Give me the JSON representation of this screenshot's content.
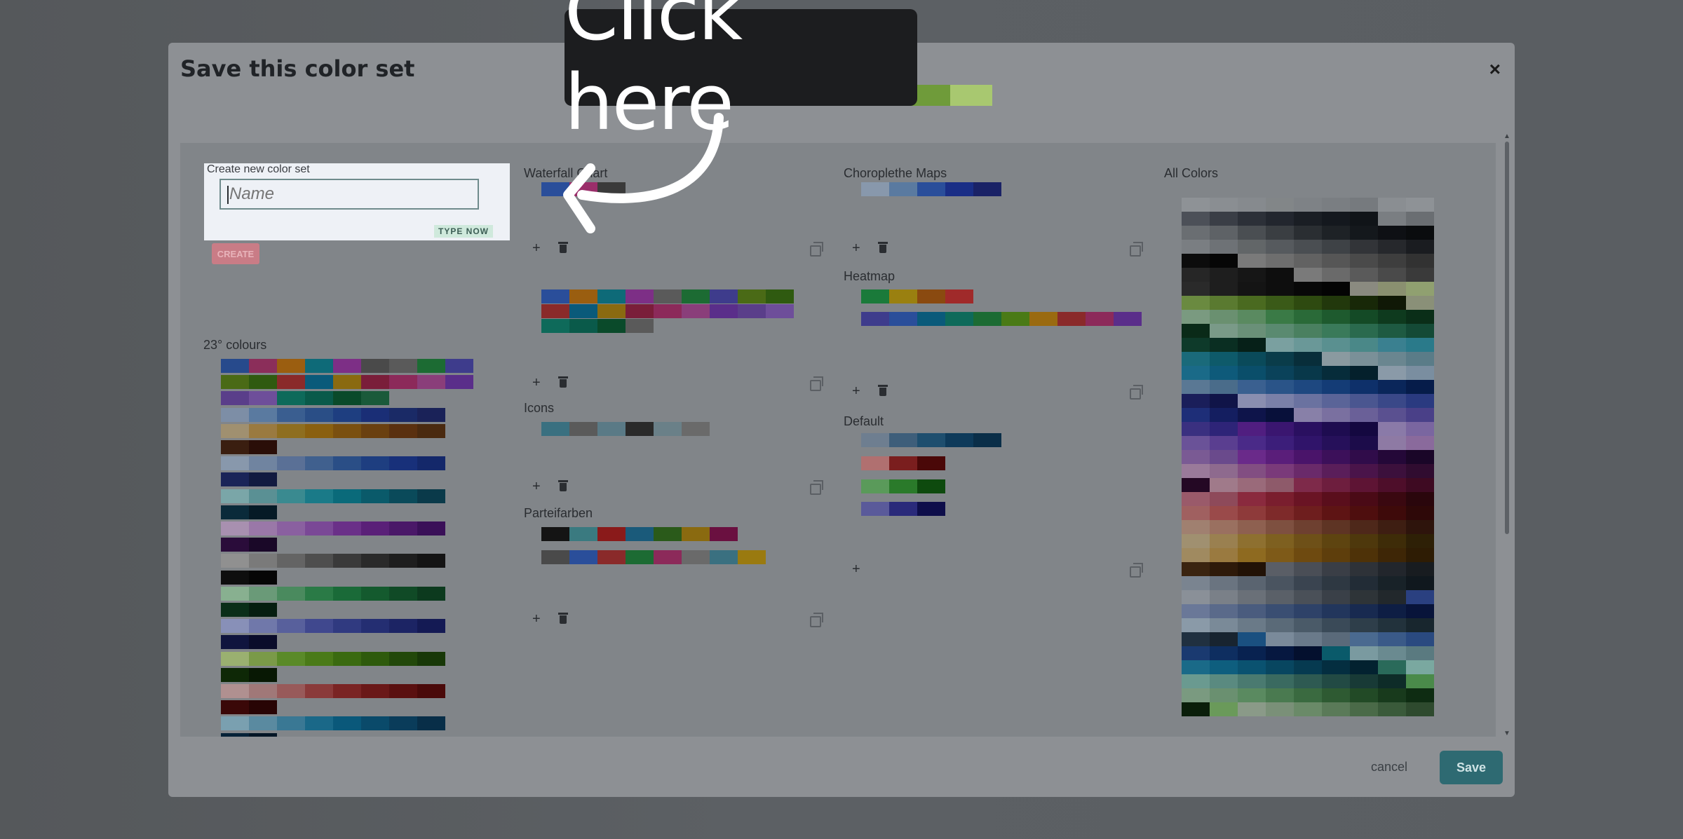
{
  "modal": {
    "title": "Save this color set",
    "close_icon": "×"
  },
  "preview_colors": [
    "#000000",
    "#1e2a12",
    "#3a5a1c",
    "#6f9b3a",
    "#a8c870"
  ],
  "create": {
    "label": "Create new color set",
    "placeholder": "Name",
    "type_now": "TYPE NOW",
    "create_button": "CREATE"
  },
  "sections": {
    "col1_title": "23° colours",
    "waterfall_title": "Waterfall Chart",
    "icons_title": "Icons",
    "parteifarben_title": "Parteifarben",
    "choropleth_title": "Choroplethe Maps",
    "heatmap_title": "Heatmap",
    "default_title": "Default",
    "all_colors_title": "All Colors"
  },
  "icons": {
    "add": "+",
    "delete": "trash-icon",
    "copy": "copy-icon"
  },
  "footer": {
    "cancel_label": "cancel",
    "save_label": "Save"
  },
  "tooltip": {
    "text": "Click here"
  },
  "colors": {
    "col1": [
      [
        "#274a8c",
        "#8b2e5a",
        "#9b5e10",
        "#0e6a78",
        "#7d2f86",
        "#4a4a4a",
        "#5a5a5a",
        "#1c6b33",
        "#3e3c8c"
      ],
      [
        "#4a6a16",
        "#2f5a10",
        "#8a2a2a",
        "#0a5a7a",
        "#8a6a10",
        "#7a1e3a",
        "#8c2a5a",
        "#8a3e7a",
        "#5a2e8a"
      ],
      [
        "#5a3e8a",
        "#6e4e9a",
        "#0e6a5a",
        "#0a5a4a",
        "#0a4a2a",
        "#1a5a3a"
      ],
      [
        "#7d8ea6",
        "#5a7aa0",
        "#3a5e90",
        "#2a4e86",
        "#1e3e80",
        "#1a2e76",
        "#1a2a66",
        "#1a2258"
      ],
      [
        "#a09070",
        "#9a7a40",
        "#8e6e20",
        "#8a6010",
        "#7a5010",
        "#6a4010",
        "#5a3010",
        "#4a2a10"
      ],
      [
        "#3a1e10",
        "#2a0e08"
      ],
      [
        "#8898ac",
        "#7084a0",
        "#5a7096",
        "#40608e",
        "#2a4e86",
        "#1e3e80",
        "#18307a",
        "#14286a"
      ],
      [
        "#1a2458",
        "#121a40"
      ],
      [
        "#7aa6a8",
        "#5a9094",
        "#3a8a90",
        "#1a7a88",
        "#0a6a7a",
        "#0a5a6a",
        "#0a4a5a",
        "#0a3a4a"
      ],
      [
        "#0a2a3a",
        "#061a26"
      ],
      [
        "#a890b0",
        "#9a78a8",
        "#8a60a0",
        "#7a4896",
        "#6a3088",
        "#5a2078",
        "#4a1868",
        "#3a1058"
      ],
      [
        "#2a0c3a",
        "#1a0828"
      ],
      [
        "#909090",
        "#7a7a7a",
        "#646464",
        "#4e4e4e",
        "#3a3a3a",
        "#2a2a2a",
        "#1e1e1e",
        "#141414"
      ],
      [
        "#0e0e0e",
        "#060606"
      ],
      [
        "#88b090",
        "#6a9a78",
        "#4a8a5e",
        "#2a7a46",
        "#1a6a38",
        "#145a2e",
        "#104a26",
        "#0c3a1e"
      ],
      [
        "#0a2e18",
        "#061e10"
      ],
      [
        "#8890b8",
        "#7078aa",
        "#58609c",
        "#40488e",
        "#303a80",
        "#242e72",
        "#1c2464",
        "#141a54"
      ],
      [
        "#10143e",
        "#0a0c2a"
      ],
      [
        "#9ab070",
        "#7a9a48",
        "#5a8a28",
        "#4a7a18",
        "#3a6a10",
        "#2e5a0c",
        "#22480a",
        "#183808"
      ],
      [
        "#0e2806",
        "#081804"
      ],
      [
        "#b09090",
        "#a07878",
        "#985a5a",
        "#8a3a3a",
        "#7a2424",
        "#6a1818",
        "#5a1010",
        "#4a0a0a"
      ],
      [
        "#3a0808",
        "#280404"
      ],
      [
        "#7aa0b0",
        "#5a8aa0",
        "#3a7894",
        "#1a6888",
        "#0a587a",
        "#0a4a6a",
        "#0a3c5a",
        "#082e48"
      ],
      [
        "#062238",
        "#041626"
      ],
      [
        "#b0a070",
        "#a09050",
        "#908030",
        "#806a1a",
        "#705a12",
        "#604a0e",
        "#503c0a",
        "#402e08"
      ],
      [
        "#302006",
        "#201404"
      ]
    ],
    "waterfall_1": [
      "#2a4e9a",
      "#9a2e6a",
      "#3a3a3a"
    ],
    "waterfall_2": [
      [
        "#2a4e9a",
        "#9a5e10",
        "#0e6a78",
        "#7d2f86",
        "#5a5a5a",
        "#1c6b33",
        "#3e3c8c",
        "#4a6a16",
        "#2f5a10"
      ],
      [
        "#8a2a2a",
        "#0a5a7a",
        "#8a6a10",
        "#7a1e3a",
        "#8c2a5a",
        "#8a3e7a",
        "#5a2e8a",
        "#5a3e8a",
        "#6e4e9a"
      ],
      [
        "#0e6a5a",
        "#0a5a4a",
        "#0a4a2a",
        "#5a5a5a"
      ]
    ],
    "icons_row": [
      "#3a7080",
      "#5a5a5a",
      "#5a7a86",
      "#2a2a2a",
      "#6a8088",
      "#6a6a6a"
    ],
    "parteifarben_1": [
      "#141414",
      "#3a7a80",
      "#8a1a1a",
      "#1a5a7a",
      "#2a5a1a",
      "#8a6a10",
      "#6a1040"
    ],
    "parteifarben_2": [
      "#4a4a4a",
      "#2a4e9a",
      "#8a2a2a",
      "#1c6b33",
      "#8c2a5a",
      "#6a6a6a",
      "#3a7080",
      "#9a7a10"
    ],
    "choropleth": [
      "#8898ac",
      "#5a7aa0",
      "#2a4e9a",
      "#1a2e86",
      "#1a2266"
    ],
    "heatmap_1": [
      "#1a7a3a",
      "#9a8010",
      "#8a4a10",
      "#a02a2a"
    ],
    "heatmap_2": [
      "#3e3c8c",
      "#2a4e9a",
      "#0a5a7a",
      "#0e6a5a",
      "#1c6b33",
      "#4a7a16",
      "#9a6a10",
      "#8a2a2a",
      "#8c2a5a",
      "#5a2e8a"
    ],
    "default_1": [
      "#6e7e90",
      "#3e5e7a",
      "#1e4e6e",
      "#0e3a5a",
      "#0a2e48"
    ],
    "default_2": [
      "#b07070",
      "#7a1e1e",
      "#4a0808"
    ],
    "default_3": [
      "#5a9a5a",
      "#2a7a2a",
      "#0e4a0e"
    ],
    "default_4": [
      "#5a5a9a",
      "#2a2a7a",
      "#0e0e4a"
    ],
    "all_colors": [
      "#8e9296",
      "#8a8e92",
      "#868a8e",
      "#828688",
      "#7e8286",
      "#7a7e82",
      "#767a7e",
      "#8a8e92",
      "#8e9296",
      "#4c5058",
      "#3a3e46",
      "#2c3038",
      "#22262e",
      "#1a1e24",
      "#14181e",
      "#101418",
      "#7a7e82",
      "#6a6e72",
      "#6a6e72",
      "#5e6266",
      "#4a4e52",
      "#3a3e42",
      "#2a2e32",
      "#1e2226",
      "#14181c",
      "#0e1014",
      "#0a0c0e",
      "#7a7e82",
      "#6e7276",
      "#626668",
      "#565a5e",
      "#4a4e52",
      "#3e4246",
      "#323438",
      "#26282c",
      "#1a1c20",
      "#0c0c0c",
      "#060606",
      "#7a7a7a",
      "#6e6e6e",
      "#626262",
      "#565656",
      "#4a4a4a",
      "#3e3e3e",
      "#323232",
      "#262626",
      "#1e1e1e",
      "#161616",
      "#0e0e0e",
      "#7a7a7a",
      "#6a6a6a",
      "#5a5a5a",
      "#4a4a4a",
      "#3a3a3a",
      "#2a2a2a",
      "#1e1e1e",
      "#141414",
      "#0e0e0e",
      "#080808",
      "#040404",
      "#8a8a80",
      "#8a9070",
      "#90a070",
      "#6a8a40",
      "#5a7a30",
      "#4a6a20",
      "#3a5a18",
      "#2e4a10",
      "#22380c",
      "#182808",
      "#101806",
      "#8a9078",
      "#7a9a80",
      "#6a9070",
      "#5a8a60",
      "#3a7a46",
      "#2a6a38",
      "#1e5a2e",
      "#144a26",
      "#0e3a1e",
      "#0a2e18",
      "#0a2a18",
      "#7a9a88",
      "#6a9078",
      "#5a8a70",
      "#4a8060",
      "#3a7a5a",
      "#2a6a4e",
      "#1e5a42",
      "#144a36",
      "#0e3a2a",
      "#0a2e22",
      "#062018",
      "#7aa0a0",
      "#6a9898",
      "#5a9090",
      "#4a8888",
      "#3a8090",
      "#2a7a8a",
      "#1a6a7a",
      "#0e5a6a",
      "#0a4a5a",
      "#0a3c4a",
      "#082e3a",
      "#8a9aa0",
      "#7a9098",
      "#6a8690",
      "#5a7c88",
      "#1a6a88",
      "#0e5a7a",
      "#0a4e6a",
      "#0a425a",
      "#08384a",
      "#062c3a",
      "#04202c",
      "#8a9aa8",
      "#7a8ea0",
      "#5a7894",
      "#4a6c8a",
      "#3a6090",
      "#2a5488",
      "#1e4880",
      "#143c76",
      "#0e306a",
      "#0a265a",
      "#061c4a",
      "#1a1e5a",
      "#101448",
      "#8a8eb0",
      "#7a80a8",
      "#6a72a0",
      "#5a6498",
      "#4a5690",
      "#3a4888",
      "#2a3a80",
      "#1e2e78",
      "#141e60",
      "#0e144a",
      "#08103a",
      "#8880a8",
      "#7a70a0",
      "#6a6098",
      "#5a5090",
      "#4a4088",
      "#3a3080",
      "#2e2478",
      "#501e80",
      "#3a1670",
      "#2a1060",
      "#1e0c50",
      "#140840",
      "#8a7aa8",
      "#7a66a0",
      "#6a5298",
      "#5a3e90",
      "#4a2a88",
      "#3c1e7a",
      "#30146a",
      "#26105a",
      "#1c0c4a",
      "#8e7aa4",
      "#8a6a9c",
      "#7a5a94",
      "#6a4a8c",
      "#6a2a8a",
      "#5a1e7a",
      "#4a146a",
      "#3c105a",
      "#300c4a",
      "#240838",
      "#1a0628",
      "#9a7a9a",
      "#8e6a8e",
      "#824e82",
      "#7a3a7a",
      "#6a2a6a",
      "#5a1e5a",
      "#4a144a",
      "#3c103c",
      "#300c30",
      "#240824",
      "#a07a8a",
      "#9a6a7a",
      "#8e5a6a",
      "#7e2a4a",
      "#6e1e3e",
      "#5e1434",
      "#4e0e2a",
      "#3e0a22",
      "#9a5a6a",
      "#8e4a5a",
      "#8a2a3e",
      "#7a1e2e",
      "#6a1424",
      "#5a0e1c",
      "#4a0a16",
      "#3a0810",
      "#2a060c",
      "#a06060",
      "#9a4a4a",
      "#8e3a3a",
      "#7e2a2a",
      "#6e1e1e",
      "#5e1414",
      "#4e0e0e",
      "#3e0a0a",
      "#2e0808",
      "#a08070",
      "#9a7060",
      "#8e6050",
      "#7e5040",
      "#6e4030",
      "#5e3424",
      "#4e281a",
      "#3e1e12",
      "#2e140c",
      "#a09070",
      "#9a8050",
      "#8e7030",
      "#7e6020",
      "#6e5018",
      "#5e4410",
      "#4e380c",
      "#3e2c08",
      "#2e2006",
      "#a08a60",
      "#9a7a40",
      "#8e6a20",
      "#7e5a18",
      "#6e4a10",
      "#5e3e0c",
      "#4e3208",
      "#3e2606",
      "#2e1c04",
      "#3a2410",
      "#2e1a0a",
      "#221206",
      "#5a5e66",
      "#4a4e56",
      "#3a3e46",
      "#2e3238",
      "#22262c",
      "#181c20",
      "#7a8490",
      "#6a7480",
      "#5a6470",
      "#4a5460",
      "#3a4450",
      "#2e3842",
      "#222c36",
      "#182228",
      "#10181e",
      "#8a9098",
      "#7a8088",
      "#6a7078",
      "#5a6068",
      "#4a5058",
      "#3a4048",
      "#2e3438",
      "#22282c",
      "#2a4080",
      "#6a7898",
      "#5a6a8a",
      "#4a5c7e",
      "#3a4e72",
      "#2e4268",
      "#22365c",
      "#182a50",
      "#0e1e44",
      "#08143a",
      "#8a9aa8",
      "#7a8a98",
      "#6a7a88",
      "#5a6a78",
      "#4a5a68",
      "#3a4a58",
      "#2e3e4a",
      "#22323c",
      "#18262e",
      "#203040",
      "#182430",
      "#1a5080",
      "#7a8a9a",
      "#6a7a8a",
      "#5a6a7a",
      "#4a6a90",
      "#3a5a88",
      "#2a4a80",
      "#1a3a70",
      "#0e2e60",
      "#082250",
      "#061840",
      "#04102e",
      "#0a5a6a",
      "#7a9aa0",
      "#6a8a90",
      "#5a7a80",
      "#1a6a88",
      "#0e5e7e",
      "#0a5270",
      "#084660",
      "#063a50",
      "#042e40",
      "#032230",
      "#2a6a5a",
      "#7aa8a0",
      "#6a9a90",
      "#5a8a80",
      "#4a7a70",
      "#3a6a60",
      "#2e5a52",
      "#224a44",
      "#183a36",
      "#0e2c28",
      "#4a8a4a",
      "#7a9a80",
      "#6a9070",
      "#5a8a60",
      "#4a7a50",
      "#3a6a40",
      "#2e5a32",
      "#224a26",
      "#183a1c",
      "#0e2c12",
      "#0a1e0a",
      "#6a9a5a",
      "#8a9a88",
      "#7a9078",
      "#6a8a68",
      "#5a7a58",
      "#4a6a48",
      "#3a5a3a",
      "#2e4a2e"
    ]
  }
}
